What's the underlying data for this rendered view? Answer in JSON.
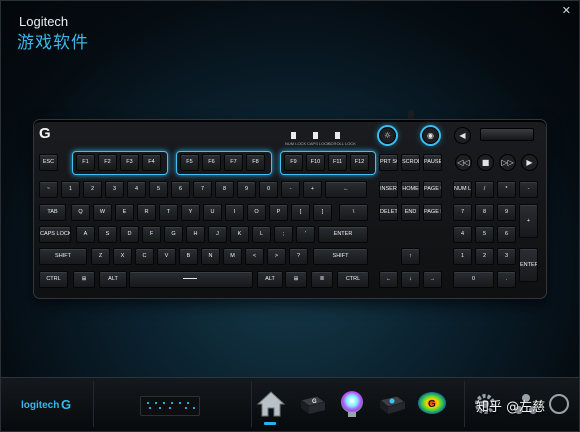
{
  "header": {
    "brand": "Logitech",
    "subtitle": "游戏软件",
    "close_glyph": "✕"
  },
  "keyboard": {
    "logo_glyph": "G",
    "indicators": [
      "NUM LOCK",
      "CAPS LOCK",
      "SCROLL LOCK"
    ],
    "glow_color": "#3fc3f5",
    "rows": {
      "fn": [
        "ESC",
        "F1",
        "F2",
        "F3",
        "F4",
        "F5",
        "F6",
        "F7",
        "F8",
        "F9",
        "F10",
        "F11",
        "F12",
        "PRT SC",
        "SCROLL LOCK",
        "PAUSE BREAK"
      ],
      "num": [
        "~",
        "1",
        "2",
        "3",
        "4",
        "5",
        "6",
        "7",
        "8",
        "9",
        "0",
        "-",
        "+",
        "←",
        "INSERT",
        "HOME",
        "PAGE UP",
        "NUM LOCK",
        "/",
        "*",
        "-"
      ],
      "qwerty": [
        "TAB",
        "Q",
        "W",
        "E",
        "R",
        "T",
        "Y",
        "U",
        "I",
        "O",
        "P",
        "[",
        "]",
        "\\",
        "DELETE",
        "END",
        "PAGE DOWN",
        "7",
        "8",
        "9",
        "+"
      ],
      "home": [
        "CAPS LOCK",
        "A",
        "S",
        "D",
        "F",
        "G",
        "H",
        "J",
        "K",
        "L",
        ";",
        "'",
        "ENTER",
        "4",
        "5",
        "6"
      ],
      "shift": [
        "SHIFT",
        "Z",
        "X",
        "C",
        "V",
        "B",
        "N",
        "M",
        "<",
        ">",
        "?",
        "SHIFT",
        "↑",
        "1",
        "2",
        "3",
        "ENTER"
      ],
      "bottom": [
        "CTRL",
        "⊞",
        "ALT",
        "",
        "ALT",
        "⊞",
        "≣",
        "CTRL",
        "←",
        "↓",
        "→",
        "0",
        "."
      ]
    },
    "media": [
      "☼",
      "◉",
      "◀",
      "◁◁",
      "■",
      "▷▷",
      "▶"
    ]
  },
  "footer": {
    "logo_text": "logitech",
    "logo_g": "G",
    "watermark": "知乎 @左慈"
  },
  "nav": {
    "items": [
      "home",
      "g-keys",
      "lighting",
      "gaming-mode",
      "heatmap",
      "settings",
      "share",
      "help"
    ]
  }
}
